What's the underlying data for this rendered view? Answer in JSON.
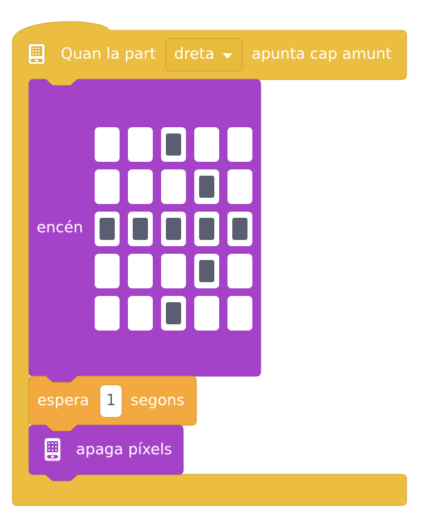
{
  "hat_block": {
    "label_before": "Quan la part",
    "dropdown_value": "dreta",
    "label_after": "apunta cap amunt",
    "icon": "microbit-device-icon",
    "color": "#ebbd40"
  },
  "display_block": {
    "label": "encén",
    "color": "#a543c8",
    "matrix": [
      [
        0,
        0,
        1,
        0,
        0
      ],
      [
        0,
        0,
        0,
        1,
        0
      ],
      [
        1,
        1,
        1,
        1,
        1
      ],
      [
        0,
        0,
        0,
        1,
        0
      ],
      [
        0,
        0,
        1,
        0,
        0
      ]
    ],
    "led_on_color": "#5b5d71"
  },
  "wait_block": {
    "label_before": "espera",
    "value": "1",
    "label_after": "segons",
    "color": "#f2a93f"
  },
  "clear_block": {
    "label": "apaga píxels",
    "icon": "microbit-device-icon",
    "color": "#a543c8"
  }
}
